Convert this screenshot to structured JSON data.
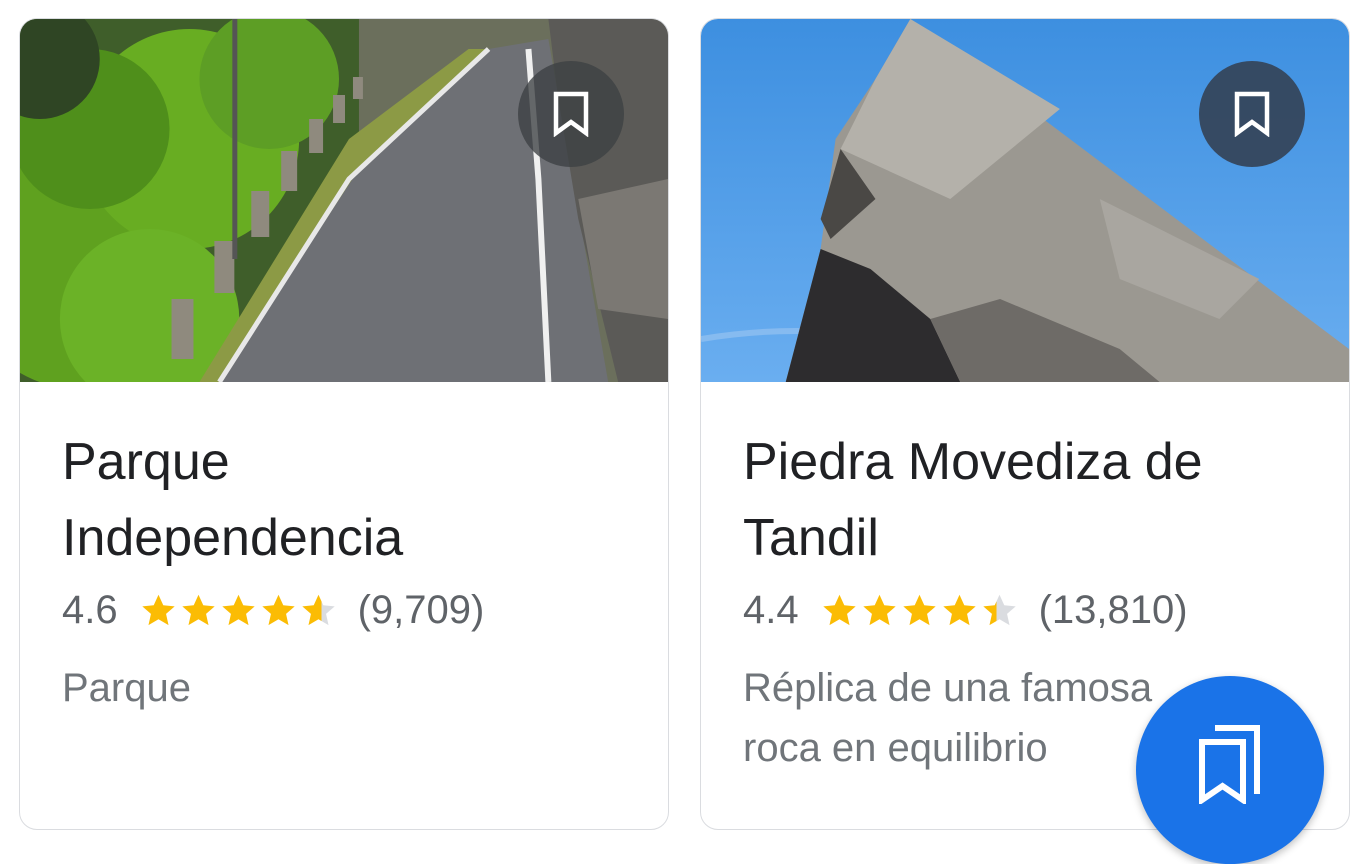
{
  "cards": [
    {
      "title_line1": "Parque",
      "title_line2": "Independencia",
      "rating": "4.6",
      "rating_value": 4.6,
      "review_count": "(9,709)",
      "desc_line1": "Parque",
      "desc_line2": "",
      "image_icon": "road-park-photo",
      "save_icon": "bookmark-icon"
    },
    {
      "title_line1": "Piedra Movediza de",
      "title_line2": "Tandil",
      "rating": "4.4",
      "rating_value": 4.4,
      "review_count": "(13,810)",
      "desc_line1": "Réplica de una famosa",
      "desc_line2": "roca en equilibrio",
      "image_icon": "rock-photo",
      "save_icon": "bookmark-icon"
    }
  ],
  "fab": {
    "icon": "saved-lists-icon"
  },
  "colors": {
    "star": "#fbbc04",
    "star_empty": "#dadce0",
    "fab": "#1a73e8"
  }
}
